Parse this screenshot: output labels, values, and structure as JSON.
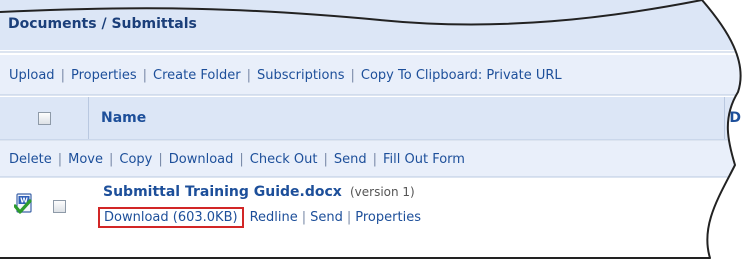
{
  "panel": {
    "title": "Documents / Submittals"
  },
  "toolbar": {
    "items": [
      "Upload",
      "Properties",
      "Create Folder",
      "Subscriptions",
      "Copy To Clipboard: Private URL"
    ],
    "separator": "|"
  },
  "list_header": {
    "name_label": "Name",
    "next_column_label": "D"
  },
  "actions": {
    "items": [
      "Delete",
      "Move",
      "Copy",
      "Download",
      "Check Out",
      "Send",
      "Fill Out Form"
    ],
    "separator": "|"
  },
  "file": {
    "name": "Submittal Training Guide.docx",
    "version": "(version 1)",
    "icon": "word-document-checked-icon",
    "links": {
      "download": "Download (603.0KB)",
      "redline": "Redline",
      "send": "Send",
      "properties": "Properties"
    }
  },
  "colors": {
    "panel_bg": "#dce6f6",
    "border": "#b9c8e0",
    "link": "#1d4f9a",
    "highlight_box": "#d22626"
  }
}
